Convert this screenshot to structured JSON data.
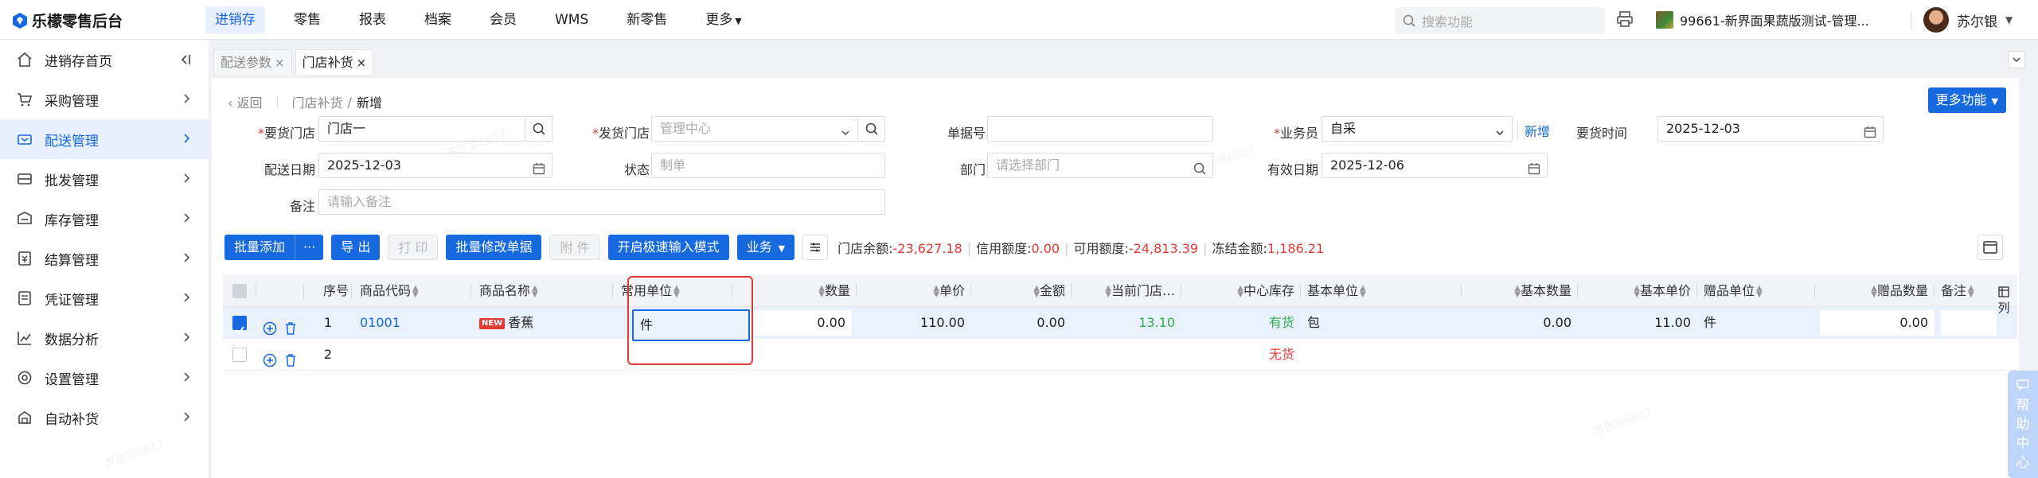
{
  "app": {
    "title": "乐檬零售后台"
  },
  "topnav": [
    "进销存",
    "零售",
    "报表",
    "档案",
    "会员",
    "WMS",
    "新零售",
    "更多"
  ],
  "topnav_active": "进销存",
  "search": {
    "placeholder": "搜索功能"
  },
  "store": {
    "name": "99661-新界面果蔬版测试-管理..."
  },
  "user": {
    "name": "苏尔银"
  },
  "sidebar": {
    "items": [
      {
        "label": "进销存首页",
        "icon": "home-icon"
      },
      {
        "label": "采购管理",
        "icon": "cart-icon"
      },
      {
        "label": "配送管理",
        "icon": "truck-icon"
      },
      {
        "label": "批发管理",
        "icon": "wholesale-icon"
      },
      {
        "label": "库存管理",
        "icon": "inventory-icon"
      },
      {
        "label": "结算管理",
        "icon": "settlement-icon"
      },
      {
        "label": "凭证管理",
        "icon": "voucher-icon"
      },
      {
        "label": "数据分析",
        "icon": "chart-icon"
      },
      {
        "label": "设置管理",
        "icon": "settings-icon"
      },
      {
        "label": "自动补货",
        "icon": "replenish-icon"
      }
    ],
    "active_index": 2
  },
  "tabs": [
    {
      "label": "配送参数",
      "close": "×"
    },
    {
      "label": "门店补货",
      "close": "×"
    }
  ],
  "breadcrumb": {
    "back": "返回",
    "parent": "门店补货",
    "sep": "/",
    "current": "新增"
  },
  "more_button": "更多功能",
  "form": {
    "req_store_label": "要货门店",
    "req_store_value": "门店一",
    "ship_store_label": "发货门店",
    "ship_store_value": "管理中心",
    "doc_no_label": "单据号",
    "doc_no_value": "",
    "salesman_label": "业务员",
    "salesman_value": "自采",
    "salesman_new": "新增",
    "req_time_label": "要货时间",
    "req_time_value": "2025-12-03",
    "ship_date_label": "配送日期",
    "ship_date_value": "2025-12-03",
    "status_label": "状态",
    "status_value": "制单",
    "dept_label": "部门",
    "dept_placeholder": "请选择部门",
    "valid_date_label": "有效日期",
    "valid_date_value": "2025-12-06",
    "remark_label": "备注",
    "remark_placeholder": "请输入备注"
  },
  "toolbar": {
    "batch_add": "批量添加",
    "more": "···",
    "export": "导 出",
    "print": "打 印",
    "batch_modify": "批量修改单据",
    "attach": "附 件",
    "fast_input": "开启极速输入模式",
    "business": "业务"
  },
  "balance": {
    "store_balance_label": "门店余额:",
    "store_balance": "-23,627.18",
    "credit_label": "信用额度:",
    "credit": "0.00",
    "available_label": "可用额度:",
    "available": "-24,813.39",
    "frozen_label": "冻结金额:",
    "frozen": "1,186.21"
  },
  "table": {
    "headers": {
      "seq": "序号",
      "code": "商品代码",
      "name": "商品名称",
      "unit": "常用单位",
      "qty": "数量",
      "price": "单价",
      "amount": "金额",
      "store_stock": "当前门店…",
      "center_stock": "中心库存",
      "base_unit": "基本单位",
      "base_qty": "基本数量",
      "base_price": "基本单价",
      "gift_unit": "赠品单位",
      "gift_qty": "赠品数量",
      "remark": "备注",
      "col": "列"
    },
    "rows": [
      {
        "seq": "1",
        "code": "01001",
        "new_tag": "NEW",
        "name": "香蕉",
        "unit": "件",
        "qty": "0.00",
        "price": "110.00",
        "amount": "0.00",
        "store_stock": "13.10",
        "center_stock": "有货",
        "base_unit": "包",
        "base_qty": "0.00",
        "base_price": "11.00",
        "gift_unit": "件",
        "gift_qty": "0.00"
      },
      {
        "seq": "2",
        "center_stock": "无货"
      }
    ]
  },
  "help": "帮助中心",
  "watermark": "苏尔银6617",
  "colors": {
    "accent": "#1769e0",
    "red": "#e53935",
    "green": "#2fae4a"
  }
}
